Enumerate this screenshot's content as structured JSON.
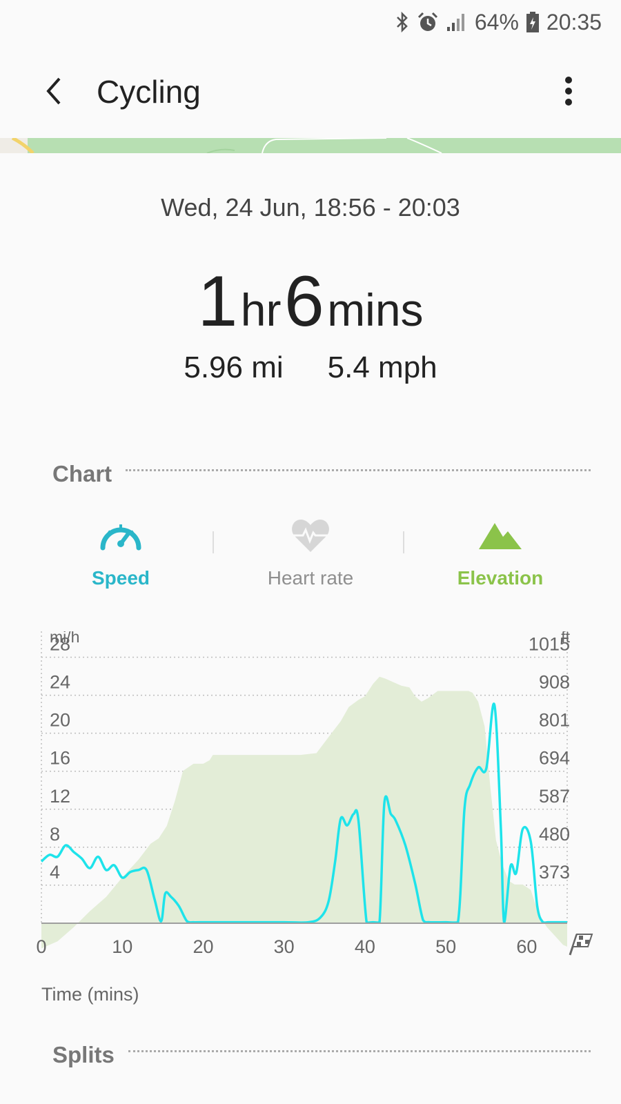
{
  "status_bar": {
    "battery": "64%",
    "time": "20:35"
  },
  "app_bar": {
    "title": "Cycling"
  },
  "summary": {
    "date_range": "Wed, 24 Jun, 18:56 - 20:03",
    "hours": "1",
    "hours_unit": "hr",
    "minutes": "6",
    "minutes_unit": "mins",
    "distance": "5.96 mi",
    "avg_speed": "5.4 mph"
  },
  "sections": {
    "chart": "Chart",
    "splits": "Splits"
  },
  "tabs": [
    {
      "label": "Speed",
      "icon": "speedometer-icon",
      "active": true,
      "color": "#2ab6c9"
    },
    {
      "label": "Heart rate",
      "icon": "heart-rate-icon",
      "active": false,
      "color": "#9a9a9a"
    },
    {
      "label": "Elevation",
      "icon": "mountain-icon",
      "active": true,
      "color": "#8bc34a"
    }
  ],
  "colors": {
    "speed_line": "#1ee3ea",
    "elevation_fill": "#e3edd7",
    "grid": "#bdbdbd"
  },
  "chart_data": {
    "type": "line",
    "left_unit": "mi/h",
    "right_unit": "ft",
    "xlabel": "Time (mins)",
    "x_ticks": [
      0,
      10,
      20,
      30,
      40,
      50,
      60
    ],
    "x_range": [
      0,
      65
    ],
    "y_left_ticks": [
      4,
      8,
      12,
      16,
      20,
      24,
      28
    ],
    "y_left_range": [
      0,
      30
    ],
    "y_right_ticks": [
      373,
      480,
      587,
      694,
      801,
      908,
      1015
    ],
    "series": [
      {
        "name": "Speed",
        "axis": "left",
        "x": [
          0,
          1,
          2,
          3,
          4,
          5,
          6,
          7,
          8,
          9,
          10,
          11,
          12,
          13,
          14,
          14.8,
          15.3,
          16,
          17,
          18,
          18.8,
          19.5,
          22,
          25,
          30,
          33,
          34.5,
          35.5,
          36.3,
          37,
          37.8,
          38.6,
          39.2,
          40.2,
          41,
          41.8,
          42.4,
          43.2,
          43.8,
          45,
          46.2,
          47.2,
          48,
          50,
          51.5,
          52.3,
          53,
          54,
          55,
          56,
          56.8,
          57.2,
          58,
          58.7,
          59.5,
          60.5,
          61.3,
          62,
          62.6,
          63.3,
          64,
          65
        ],
        "values": [
          6.5,
          7.2,
          7,
          8.2,
          7.5,
          6.8,
          5.8,
          7,
          5.6,
          6.1,
          4.8,
          5.4,
          5.6,
          5.6,
          2.5,
          0.2,
          3.1,
          2.8,
          1.8,
          0.2,
          0.1,
          0.1,
          0.1,
          0.1,
          0.1,
          0.1,
          0.6,
          2.3,
          6.4,
          11,
          10.3,
          11.5,
          10.8,
          0.1,
          0.1,
          0.1,
          12.7,
          11.5,
          10.8,
          8.2,
          4.2,
          0.3,
          0.1,
          0.1,
          0.1,
          12,
          14.6,
          16.4,
          16.3,
          23,
          10,
          0.1,
          6,
          5.3,
          9.9,
          8.6,
          1.8,
          0.1,
          0.1,
          0.1,
          0.1,
          0.1
        ]
      },
      {
        "name": "Elevation",
        "axis": "right",
        "x": [
          0,
          2,
          4,
          6,
          8,
          10,
          12,
          13.5,
          14.5,
          15.5,
          16.5,
          17.5,
          18.8,
          20,
          20.8,
          21.2,
          27,
          32,
          34,
          35.5,
          37,
          38,
          39.2,
          40,
          41,
          41.8,
          42.5,
          43.5,
          44.5,
          45.5,
          46.2,
          47,
          47.8,
          49,
          51,
          52.8,
          53.3,
          54,
          54.8,
          55.5,
          56.2,
          57,
          57.8,
          58.5,
          59.5,
          60.5,
          61.5,
          62.5,
          63.5,
          64.5,
          65
        ],
        "values": [
          195,
          215,
          255,
          300,
          340,
          395,
          445,
          490,
          505,
          540,
          610,
          695,
          715,
          715,
          725,
          740,
          740,
          740,
          745,
          790,
          835,
          875,
          895,
          905,
          940,
          960,
          955,
          945,
          935,
          930,
          905,
          890,
          900,
          920,
          920,
          920,
          915,
          890,
          820,
          650,
          500,
          430,
          385,
          375,
          375,
          360,
          290,
          255,
          230,
          205,
          200
        ]
      }
    ]
  }
}
